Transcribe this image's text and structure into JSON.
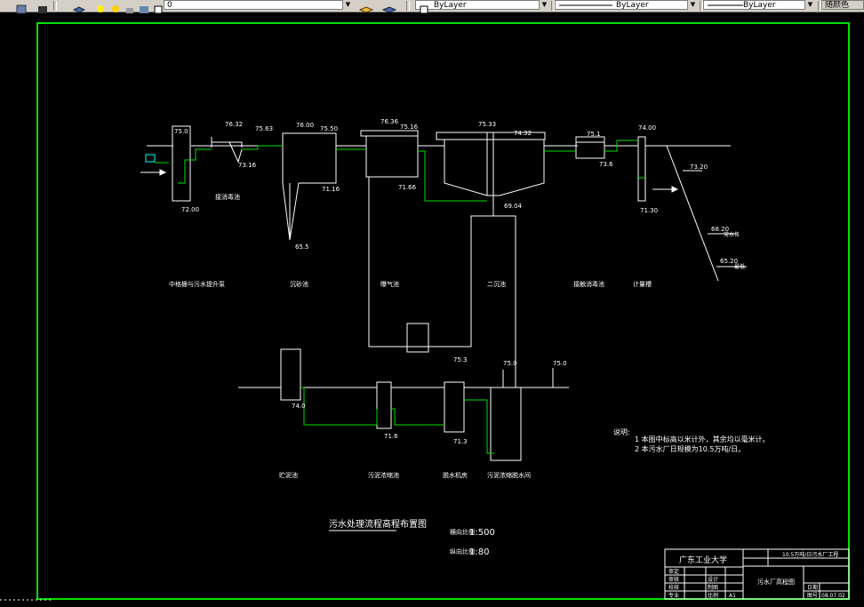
{
  "toolbar": {
    "layer_value": "0",
    "color_value": "ByLayer",
    "linetype_value": "ByLayer",
    "lineweight_value": "ByLayer",
    "plotstyle_value": "随颜色"
  },
  "drawing": {
    "elevations": {
      "e1": "75.0",
      "e2": "76.32",
      "e3": "75.63",
      "e4": "73.16",
      "e5": "76.00",
      "e6": "75.50",
      "e7": "71.16",
      "e8": "65.5",
      "e9": "76.36",
      "e10": "75.16",
      "e11": "71.66",
      "e12": "75.33",
      "e13": "74.32",
      "e14": "69.04",
      "e15": "75.1",
      "e16": "73.6",
      "e17": "74.00",
      "e18": "71.30",
      "e19": "73.20",
      "e20": "68.20",
      "e21": "65.20",
      "e22": "75.3",
      "e23": "75.0",
      "e24": "75.0",
      "e25": "74.0",
      "e26": "71.6",
      "e27": "71.3",
      "e28": "72.00"
    },
    "unit_labels": [
      "中格栅与污水提升泵",
      "沉砂池",
      "曝气池",
      "二沉池",
      "接触消毒池",
      "计量槽"
    ],
    "sludge_labels": [
      "贮泥池",
      "污泥浓缩池",
      "脱水机房",
      "污泥浓缩脱水间"
    ],
    "pipe_note": "接消毒池",
    "notes_title": "说明:",
    "notes": [
      "1 本图中标高以米计外，其余均以毫米计。",
      "2 本污水厂日规模为10.5万吨/日。"
    ],
    "drawing_title": "污水处理流程高程布置图",
    "scale_h_label": "横向比例",
    "scale_h": "1:500",
    "scale_v_label": "纵向比例",
    "scale_v": "1:80",
    "river_label_1": "常水位",
    "river_label_2": "最低"
  },
  "title_block": {
    "school": "广东工业大学",
    "project": "10.5万吨/日污水厂工程",
    "drawing_name": "污水厂高程图",
    "labels": [
      "审定",
      "审核",
      "设计",
      "校核",
      "制图",
      "比例",
      "图号",
      "专业",
      "日期"
    ],
    "values": [
      "",
      "",
      "",
      "",
      "",
      "A1",
      "08.07.02"
    ]
  },
  "colors": {
    "frame": "#00e000",
    "lines": "#ffffff",
    "pipe": "#00e000",
    "background": "#000000",
    "toolbar": "#d4d0c8"
  }
}
